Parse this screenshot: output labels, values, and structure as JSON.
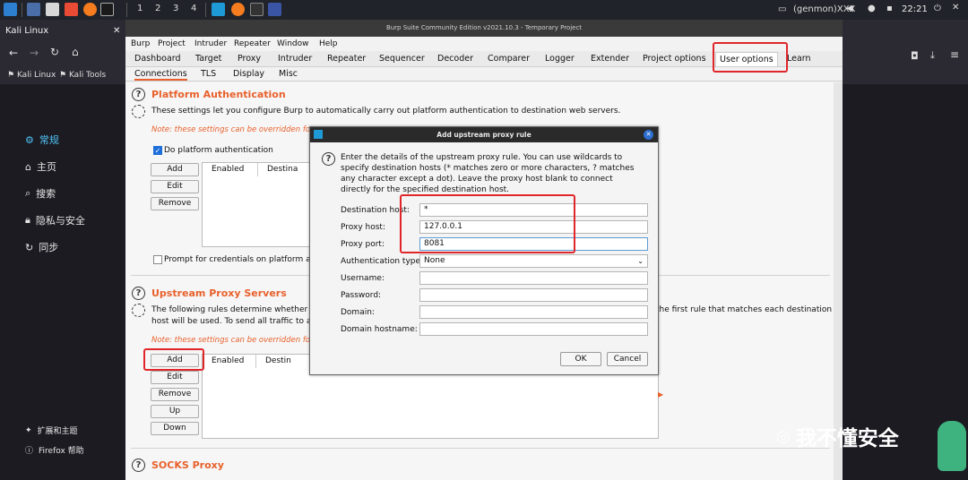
{
  "taskbar": {
    "workspaces": [
      "1",
      "2",
      "3",
      "4"
    ],
    "user": "(genmon)XXX",
    "time": "22:21"
  },
  "firefox": {
    "tab_title": "Kali Linux",
    "bookmarks": [
      "Kali Linux",
      "Kali Tools"
    ],
    "sidebar": [
      {
        "label": "常规",
        "icon": "gear-icon"
      },
      {
        "label": "主页",
        "icon": "home-icon"
      },
      {
        "label": "搜索",
        "icon": "search-icon"
      },
      {
        "label": "隐私与安全",
        "icon": "lock-icon"
      },
      {
        "label": "同步",
        "icon": "sync-icon"
      }
    ],
    "footer": [
      {
        "label": "扩展和主题",
        "icon": "puzzle-icon"
      },
      {
        "label": "Firefox 帮助",
        "icon": "help-icon"
      }
    ]
  },
  "burp": {
    "window_title": "Burp Suite Community Edition v2021.10.3 - Temporary Project",
    "menu": [
      "Burp",
      "Project",
      "Intruder",
      "Repeater",
      "Window",
      "Help"
    ],
    "tabs": [
      "Dashboard",
      "Target",
      "Proxy",
      "Intruder",
      "Repeater",
      "Sequencer",
      "Decoder",
      "Comparer",
      "Logger",
      "Extender",
      "Project options",
      "User options",
      "Learn"
    ],
    "active_tab": "User options",
    "subtabs": [
      "Connections",
      "TLS",
      "Display",
      "Misc"
    ],
    "active_subtab": "Connections",
    "platform_auth": {
      "title": "Platform Authentication",
      "desc": "These settings let you configure Burp to automatically carry out platform authentication to destination web servers.",
      "note": "Note: these settings can be overridden fo",
      "checkbox": "Do platform authentication",
      "buttons": [
        "Add",
        "Edit",
        "Remove"
      ],
      "columns": [
        "Enabled",
        "Destina"
      ],
      "prompt": "Prompt for credentials on platform aut"
    },
    "upstream": {
      "title": "Upstream Proxy Servers",
      "desc_line1": "The following rules determine whether Bu",
      "desc_line2": "host will be used. To send all traffic to a si",
      "desc_right": "the first rule that matches each destination",
      "note": "Note: these settings can be overridden fo",
      "buttons": [
        "Add",
        "Edit",
        "Remove",
        "Up",
        "Down"
      ],
      "columns": [
        "Enabled",
        "Destin"
      ]
    },
    "socks": {
      "title": "SOCKS Proxy"
    }
  },
  "dialog": {
    "title": "Add upstream proxy rule",
    "description": "Enter the details of the upstream proxy rule. You can use wildcards to specify destination hosts (* matches zero or more characters, ? matches any character except a dot). Leave the proxy host blank to connect directly for the specified destination host.",
    "fields": {
      "destination_host_label": "Destination host:",
      "destination_host": "*",
      "proxy_host_label": "Proxy host:",
      "proxy_host": "127.0.0.1",
      "proxy_port_label": "Proxy port:",
      "proxy_port": "8081",
      "auth_type_label": "Authentication type:",
      "auth_type": "None",
      "username_label": "Username:",
      "password_label": "Password:",
      "domain_label": "Domain:",
      "domain_hostname_label": "Domain hostname:"
    },
    "ok": "OK",
    "cancel": "Cancel"
  },
  "watermark": "我不懂安全",
  "colors": {
    "accent": "#e8612c",
    "highlight": "#e0262b"
  }
}
